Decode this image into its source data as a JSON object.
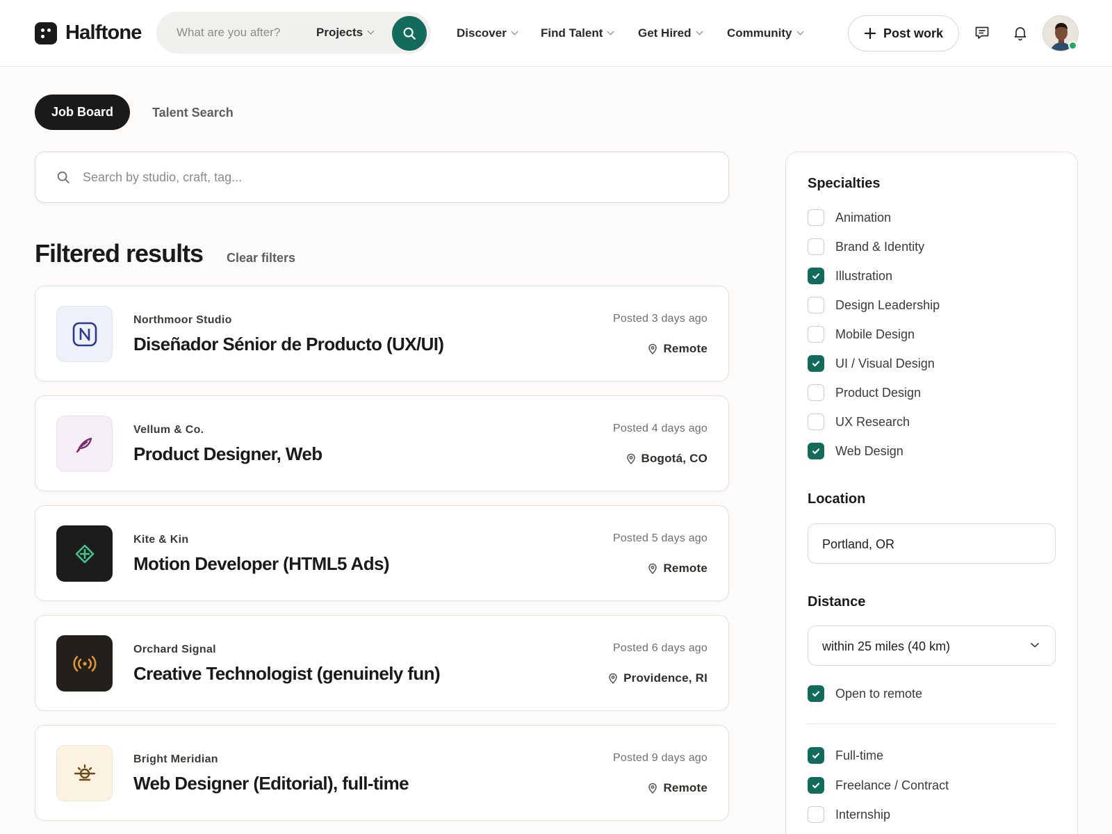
{
  "brand": {
    "name": "Halftone"
  },
  "header": {
    "search_placeholder": "What are you after?",
    "search_scope": "Projects",
    "nav": [
      "Discover",
      "Find Talent",
      "Get Hired",
      "Community"
    ],
    "post_work_label": "Post work"
  },
  "tabs": {
    "active": "Job Board",
    "other": "Talent Search"
  },
  "main_search": {
    "placeholder": "Search by studio, craft, tag..."
  },
  "results": {
    "title": "Filtered results",
    "clear_label": "Clear filters"
  },
  "jobs": [
    {
      "company": "Northmoor Studio",
      "title": "Diseñador Sénior de Producto (UX/UI)",
      "posted": "Posted 3 days ago",
      "location": "Remote",
      "logo_icon": "letter-n-icon",
      "logo_bg": "#eef0fb",
      "logo_color": "#2b3a8c"
    },
    {
      "company": "Vellum & Co.",
      "title": "Product Designer, Web",
      "posted": "Posted 4 days ago",
      "location": "Bogotá, CO",
      "logo_icon": "quill-icon",
      "logo_bg": "#f5eef5",
      "logo_color": "#7a2c6b"
    },
    {
      "company": "Kite & Kin",
      "title": "Motion Developer (HTML5 Ads)",
      "posted": "Posted 5 days ago",
      "location": "Remote",
      "logo_icon": "kite-diamond-icon",
      "logo_bg": "#1b1d1b",
      "logo_color": "#46c38a"
    },
    {
      "company": "Orchard Signal",
      "title": "Creative Technologist (genuinely fun)",
      "posted": "Posted 6 days ago",
      "location": "Providence, RI",
      "logo_icon": "broadcast-signal-icon",
      "logo_bg": "#231f1b",
      "logo_color": "#e0973a"
    },
    {
      "company": "Bright Meridian",
      "title": "Web Designer (Editorial), full-time",
      "posted": "Posted 9 days ago",
      "location": "Remote",
      "logo_icon": "sunrise-icon",
      "logo_bg": "#fcf2e1",
      "logo_color": "#6b4a18"
    }
  ],
  "filters": {
    "specialties_heading": "Specialties",
    "specialties": [
      {
        "label": "Animation",
        "checked": false
      },
      {
        "label": "Brand & Identity",
        "checked": false
      },
      {
        "label": "Illustration",
        "checked": true
      },
      {
        "label": "Design Leadership",
        "checked": false
      },
      {
        "label": "Mobile Design",
        "checked": false
      },
      {
        "label": "UI / Visual Design",
        "checked": true
      },
      {
        "label": "Product Design",
        "checked": false
      },
      {
        "label": "UX Research",
        "checked": false
      },
      {
        "label": "Web Design",
        "checked": true
      }
    ],
    "location_heading": "Location",
    "location_value": "Portland, OR",
    "distance_heading": "Distance",
    "distance_value": "within 25 miles (40 km)",
    "open_to_remote": {
      "label": "Open to remote",
      "checked": true
    },
    "job_types": [
      {
        "label": "Full-time",
        "checked": true
      },
      {
        "label": "Freelance / Contract",
        "checked": true
      },
      {
        "label": "Internship",
        "checked": false
      }
    ]
  },
  "colors": {
    "accent": "#126b5b",
    "dark": "#1a1a1a",
    "online": "#24a865"
  }
}
